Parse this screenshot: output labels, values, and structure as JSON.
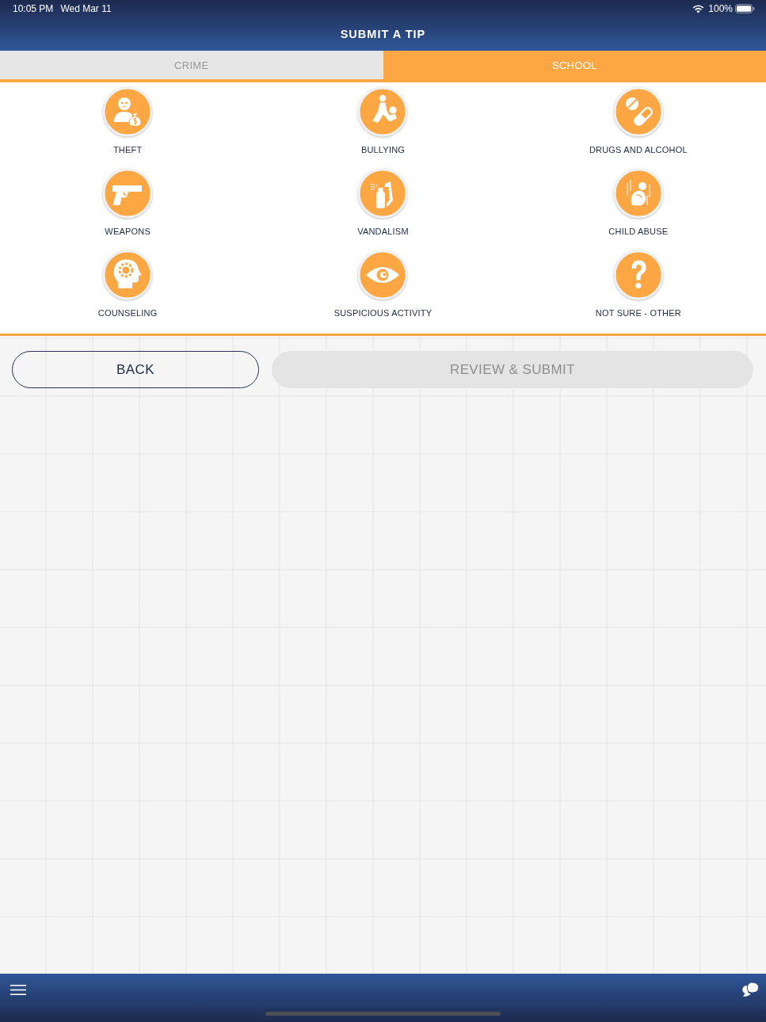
{
  "status_bar": {
    "time": "10:05 PM",
    "date": "Wed Mar 11",
    "battery": "100%"
  },
  "nav_bar": {
    "title": "SUBMIT A TIP"
  },
  "tabs": [
    {
      "label": "CRIME",
      "selected": false
    },
    {
      "label": "SCHOOL",
      "selected": true
    }
  ],
  "categories": [
    {
      "label": "THEFT"
    },
    {
      "label": "BULLYING"
    },
    {
      "label": "DRUGS AND ALCOHOL"
    },
    {
      "label": "WEAPONS"
    },
    {
      "label": "VANDALISM"
    },
    {
      "label": "CHILD ABUSE"
    },
    {
      "label": "COUNSELING"
    },
    {
      "label": "SUSPICIOUS ACTIVITY"
    },
    {
      "label": "NOT SURE - OTHER"
    }
  ],
  "buttons": [
    {
      "label": "BACK",
      "kind": "outline",
      "disabled": false
    },
    {
      "label": "REVIEW & SUBMIT",
      "kind": "filled",
      "disabled": true
    }
  ]
}
